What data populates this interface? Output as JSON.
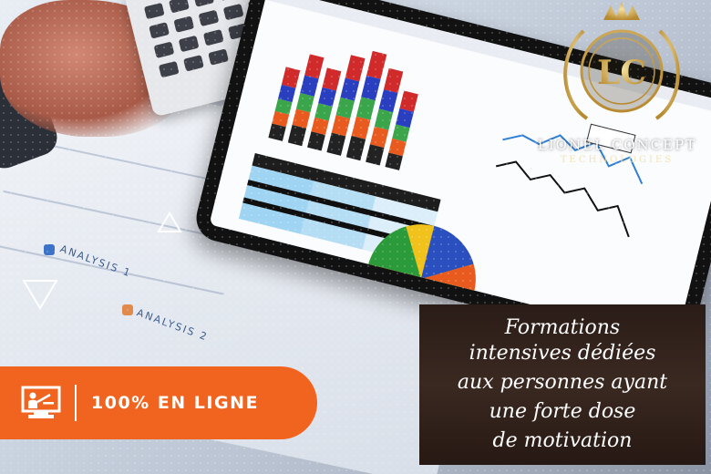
{
  "background": {
    "analysis_labels": [
      "ANALYSIS 1",
      "ANALYSIS 2"
    ]
  },
  "brand": {
    "monogram": "LC",
    "name": "LIONEL CONCEPT",
    "subtitle": "TECHNOLOGIES",
    "gold_color": "#d9b65a"
  },
  "badge": {
    "icon": "online-teaching-icon",
    "label": "100% EN LIGNE",
    "color": "#f1641f"
  },
  "motto": {
    "lines": [
      "Formations",
      "intensives dédiées",
      "aux personnes ayant",
      "une forte dose",
      "de motivation"
    ]
  }
}
